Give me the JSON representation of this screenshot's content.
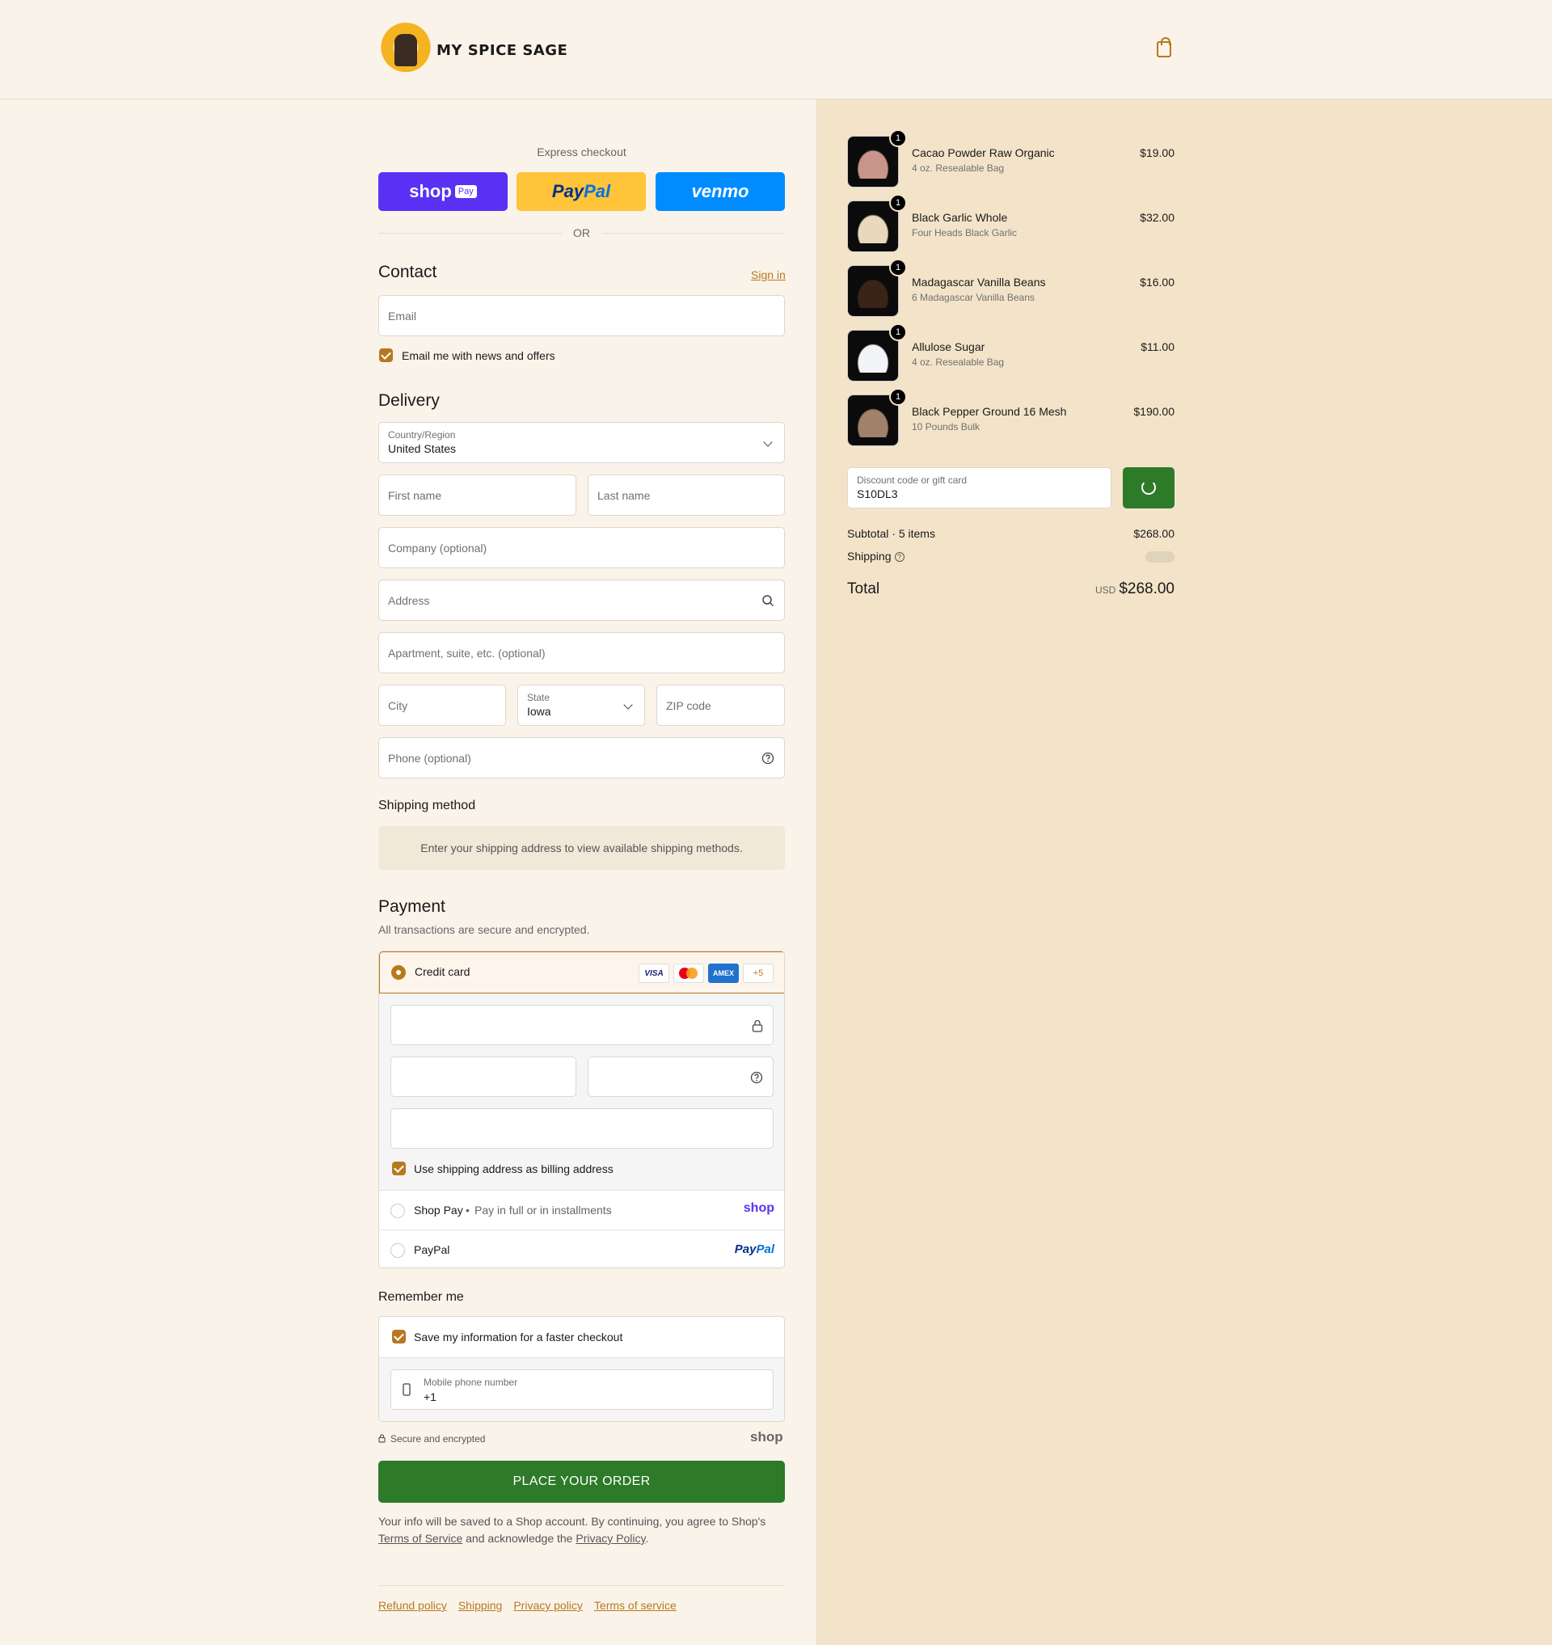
{
  "header": {
    "brand": "MY SPICE SAGE",
    "logo_icon": "spice-sage-logo",
    "cart_icon": "shopping-bag-icon"
  },
  "express": {
    "label": "Express checkout",
    "shop_pay": "shop",
    "shop_pay_tag": "Pay",
    "paypal_a": "Pay",
    "paypal_b": "Pal",
    "venmo": "venmo",
    "or": "OR"
  },
  "contact": {
    "title": "Contact",
    "sign_in": "Sign in",
    "email_placeholder": "Email",
    "news_checkbox": "Email me with news and offers",
    "news_checked": true
  },
  "delivery": {
    "title": "Delivery",
    "country_label": "Country/Region",
    "country_value": "United States",
    "first_name": "First name",
    "last_name": "Last name",
    "company": "Company (optional)",
    "address": "Address",
    "apartment": "Apartment, suite, etc. (optional)",
    "city": "City",
    "state_label": "State",
    "state_value": "Iowa",
    "zip": "ZIP code",
    "phone": "Phone (optional)"
  },
  "shipping_method": {
    "title": "Shipping method",
    "info": "Enter your shipping address to view available shipping methods."
  },
  "payment": {
    "title": "Payment",
    "subtitle": "All transactions are secure and encrypted.",
    "credit_card": "Credit card",
    "cards": [
      "VISA",
      "AMEX",
      "+5"
    ],
    "billing_checkbox": "Use shipping address as billing address",
    "shop_pay_label": "Shop Pay",
    "shop_pay_desc": "Pay in full or in installments",
    "shop_logo": "shop",
    "paypal_label": "PayPal",
    "paypal_logo_a": "Pay",
    "paypal_logo_b": "Pal"
  },
  "remember": {
    "title": "Remember me",
    "save_checkbox": "Save my information for a faster checkout",
    "phone_label": "Mobile phone number",
    "phone_value": "+1",
    "secure": "Secure and encrypted",
    "shop_logo": "shop"
  },
  "place_order": "PLACE YOUR ORDER",
  "legal": {
    "text_1": "Your info will be saved to a Shop account. By continuing, you agree to Shop's",
    "terms": "Terms of Service",
    "text_2": "and acknowledge the",
    "privacy": "Privacy Policy",
    "text_3": "."
  },
  "footer": {
    "links": [
      "Refund policy",
      "Shipping",
      "Privacy policy",
      "Terms of service"
    ]
  },
  "summary": {
    "items": [
      {
        "name": "Cacao Powder Raw Organic",
        "variant": "4 oz. Resealable Bag",
        "price": "$19.00",
        "qty": "1",
        "color": "#c9948a"
      },
      {
        "name": "Black Garlic Whole",
        "variant": "Four Heads Black Garlic",
        "price": "$32.00",
        "qty": "1",
        "color": "#e8d9bd"
      },
      {
        "name": "Madagascar Vanilla Beans",
        "variant": "6 Madagascar Vanilla Beans",
        "price": "$16.00",
        "qty": "1",
        "color": "#3a2418"
      },
      {
        "name": "Allulose Sugar",
        "variant": "4 oz. Resealable Bag",
        "price": "$11.00",
        "qty": "1",
        "color": "#f2f4f8"
      },
      {
        "name": "Black Pepper Ground 16 Mesh",
        "variant": "10 Pounds Bulk",
        "price": "$190.00",
        "qty": "1",
        "color": "#a1816a"
      }
    ],
    "discount_label": "Discount code or gift card",
    "discount_value": "S10DL3",
    "subtotal_label": "Subtotal · 5 items",
    "subtotal_value": "$268.00",
    "shipping_label": "Shipping",
    "total_label": "Total",
    "currency": "USD",
    "total_value": "$268.00"
  }
}
